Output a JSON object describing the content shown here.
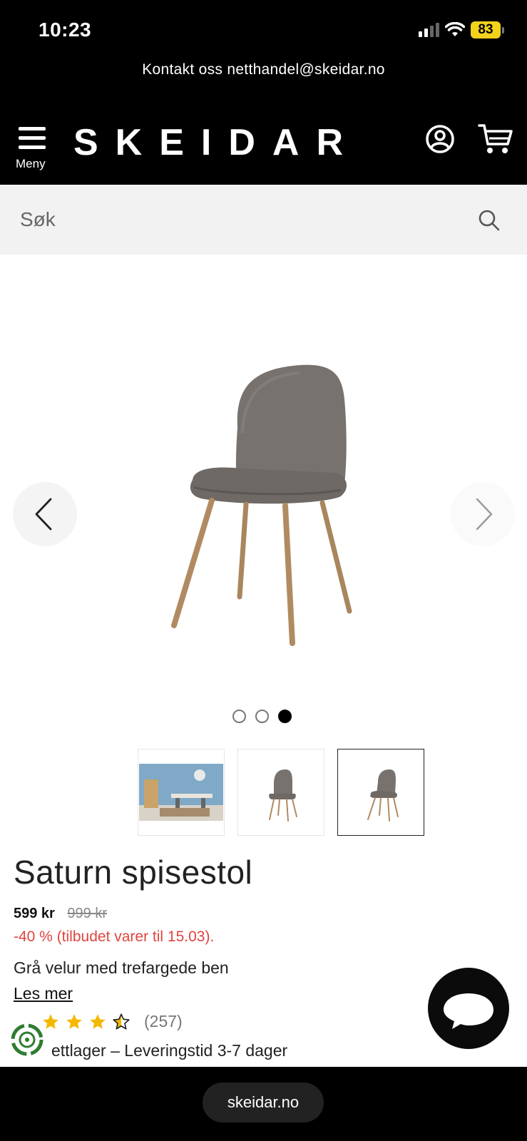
{
  "status_bar": {
    "time": "10:23",
    "battery": "83"
  },
  "header": {
    "contact": "Kontakt oss netthandel@skeidar.no",
    "menu_label": "Meny",
    "logo": "SKEIDAR"
  },
  "search": {
    "placeholder": "Søk"
  },
  "product": {
    "title": "Saturn spisestol",
    "price": "599 kr",
    "old_price": "999 kr",
    "discount": "-40 % (tilbudet varer til 15.03).",
    "description": "Grå velur med trefargede ben",
    "read_more": "Les mer",
    "rating_value": 3.5,
    "rating_max": 5,
    "rating_count": "(257)",
    "stock": "ettlager – Leveringstid 3-7 dager"
  },
  "gallery": {
    "image_count": 3,
    "active_index": 3
  },
  "browser": {
    "url": "skeidar.no"
  },
  "colors": {
    "accent": "#f2d21b",
    "discount": "#e0443e",
    "header_bg": "#000000",
    "star": "#f5b800"
  }
}
